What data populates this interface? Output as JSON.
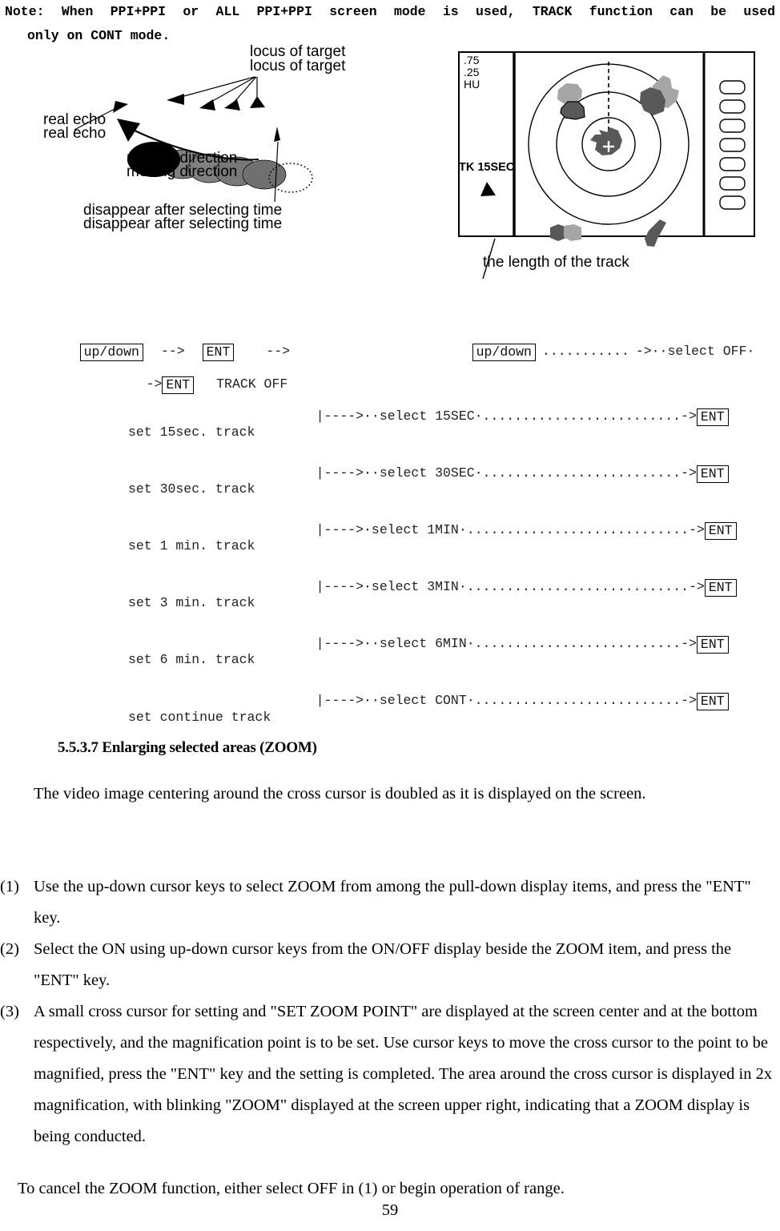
{
  "note": {
    "line1": "Note: When PPI+PPI or ALL PPI+PPI screen mode is used, TRACK function can be used",
    "line2": "only on CONT mode."
  },
  "figure_left": {
    "labels": {
      "locus_of_target": "locus of target",
      "real_echo": "real echo",
      "moving_direction": "moving direction",
      "disappear": "disappear after selecting time"
    },
    "echo_count": 5
  },
  "figure_right": {
    "screen_info": {
      "range_outer": ".75",
      "range_ring": ".25",
      "mode": "HU",
      "track_status": "TK 15SEC"
    },
    "caption": "the length of the track",
    "soft_key_count": 7,
    "range_rings": 3,
    "cursor": "+"
  },
  "flow": {
    "row1": {
      "key1": "up/down",
      "arrow1": "-->",
      "key2": "ENT",
      "arrow2": "-->",
      "key3": "up/down",
      "dots": "...........",
      "tail": "->··select OFF·"
    },
    "row2": {
      "arrow": "->",
      "key": "ENT",
      "label": "TRACK OFF"
    },
    "branches": [
      {
        "stem": "|---->··select 15SEC·",
        "dots": ".........................",
        "arrow": "->",
        "key": "ENT",
        "result": "set 15sec. track"
      },
      {
        "stem": "|---->··select 30SEC·",
        "dots": ".........................",
        "arrow": "->",
        "key": "ENT",
        "result": "set 30sec. track"
      },
      {
        "stem": "|---->·select 1MIN·",
        "dots": "............................",
        "arrow": "->",
        "key": "ENT",
        "result": "set 1 min. track"
      },
      {
        "stem": "|---->·select 3MIN·",
        "dots": "............................",
        "arrow": "->",
        "key": "ENT",
        "result": "set 3 min. track"
      },
      {
        "stem": "|---->··select 6MIN·",
        "dots": "..........................",
        "arrow": "->",
        "key": "ENT",
        "result": "set 6 min. track"
      },
      {
        "stem": "|---->··select CONT·",
        "dots": "..........................",
        "arrow": "->",
        "key": "ENT",
        "result": "set continue track"
      }
    ]
  },
  "section": {
    "heading": "5.5.3.7 Enlarging selected areas (ZOOM)",
    "intro": "The video image centering around the cross cursor is doubled as it is displayed on the screen."
  },
  "steps": [
    {
      "mark": "(1)",
      "text": "Use the up-down cursor keys to select ZOOM from among the pull-down display items, and press the \"ENT\" key."
    },
    {
      "mark": "(2)",
      "text": "Select the ON using up-down cursor keys from the ON/OFF display beside the ZOOM item, and press the \"ENT\" key."
    },
    {
      "mark": "(3)",
      "text": "A small cross cursor for setting and \"SET ZOOM POINT\" are displayed at the screen center and at the bottom respectively, and the magnification point is to be set.  Use cursor keys to move the cross cursor to the point to be magnified, press the \"ENT\" key and the setting is completed.  The area around the cross cursor is displayed in 2x magnification, with blinking \"ZOOM\" displayed at the screen upper right, indicating that a ZOOM display is being conducted."
    }
  ],
  "closing": "To cancel the ZOOM function, either select OFF in (1) or begin operation of range.",
  "page_number": "59",
  "colors": {
    "ink": "#000000",
    "echo_gray": "#808080",
    "blob_dark": "#595959",
    "blob_light": "#a6a6a6"
  }
}
